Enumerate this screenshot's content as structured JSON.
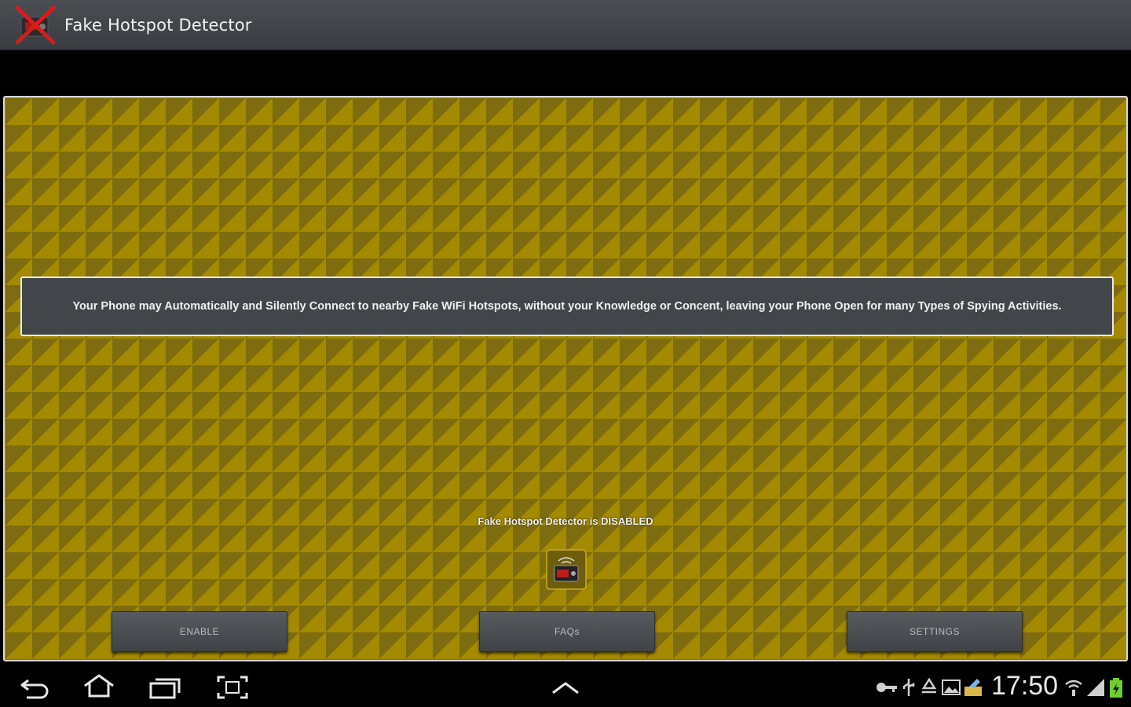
{
  "action_bar": {
    "title": "Fake Hotspot Detector",
    "icon": "app-logo-crossed-icon"
  },
  "banner": {
    "text": "Your Phone may Automatically and Silently Connect to nearby Fake WiFi Hotspots, without your Knowledge or Concent, leaving your Phone Open for many Types of Spying Activities."
  },
  "status": {
    "text": "Fake Hotspot Detector is DISABLED",
    "icon": "detector-status-icon"
  },
  "buttons": {
    "enable": "ENABLE",
    "faqs": "FAQs",
    "settings": "SETTINGS"
  },
  "nav_bar": {
    "icons": [
      "back-icon",
      "home-icon",
      "recent-apps-icon",
      "screenshot-icon",
      "chevron-up-icon"
    ]
  },
  "status_bar": {
    "time": "17:50",
    "icons": [
      "key-icon",
      "usb-icon",
      "recycle-icon",
      "gallery-icon",
      "notification-icon",
      "wifi-icon",
      "signal-icon",
      "battery-icon"
    ]
  },
  "colors": {
    "pattern_light": "#a38a00",
    "pattern_dark": "#7e6c10",
    "panel_border": "#d8d8d8",
    "banner_bg": "#42464a",
    "action_bar_bg": "#44484c",
    "battery_green": "#6fcf2a"
  }
}
